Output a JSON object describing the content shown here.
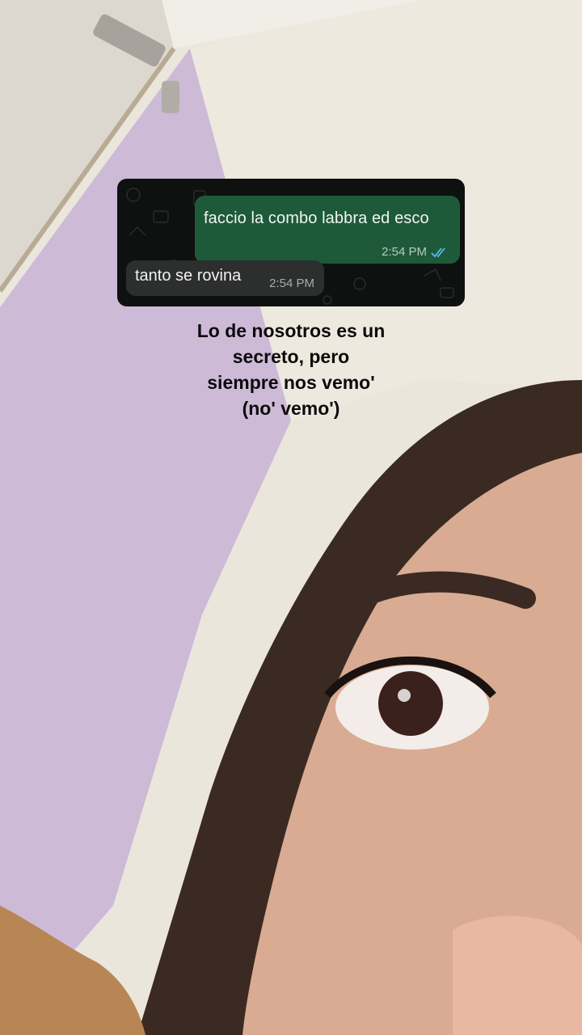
{
  "chat": {
    "outgoing_text": "faccio la combo labbra ed esco",
    "outgoing_time": "2:54 PM",
    "incoming_text": "tanto se rovina",
    "incoming_time": "2:54 PM"
  },
  "caption": {
    "lines": [
      "Lo de nosotros es un",
      "secreto, pero",
      "siempre nos vemo'",
      "(no' vemo')"
    ]
  },
  "icons": {
    "read_receipt": "double-check-icon"
  },
  "colors": {
    "outgoing_bubble": "#1e5a3a",
    "incoming_bubble": "#2d2f2e",
    "read_ticks": "#53bdeb"
  }
}
